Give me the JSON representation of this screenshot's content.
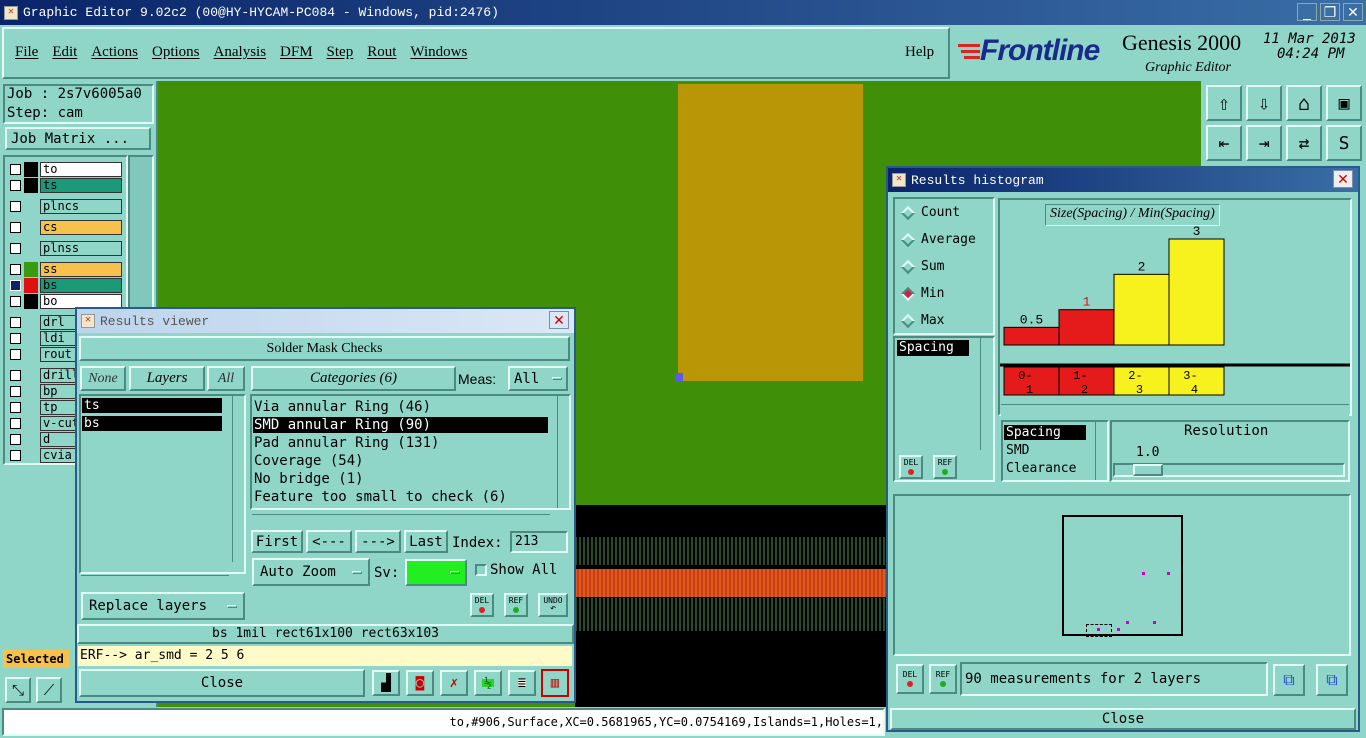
{
  "window": {
    "title": "Graphic Editor 9.02c2 (00@HY-HYCAM-PC084 - Windows, pid:2476)"
  },
  "menu": {
    "items": [
      "File",
      "Edit",
      "Actions",
      "Options",
      "Analysis",
      "DFM",
      "Step",
      "Rout",
      "Windows"
    ],
    "help": "Help"
  },
  "brand": {
    "logo": "Frontline",
    "product": "Genesis 2000",
    "subtitle": "Graphic Editor",
    "date": "11 Mar 2013",
    "time": "04:24 PM"
  },
  "job": {
    "job_label": "Job : 2s7v6005a0",
    "step_label": "Step: cam",
    "matrix_button": "Job Matrix ..."
  },
  "layers": [
    {
      "name": "to",
      "color": "#ffffff",
      "swatch": "#000000"
    },
    {
      "name": "ts",
      "color": "#1b9a7a",
      "swatch": "#000000"
    },
    {
      "name": "plncs",
      "color": "#8fd6c9",
      "swatch": ""
    },
    {
      "name": "cs",
      "color": "#f6c24b",
      "swatch": ""
    },
    {
      "name": "plnss",
      "color": "#8fd6c9",
      "swatch": ""
    },
    {
      "name": "ss",
      "color": "#f6c24b",
      "swatch": "#3a9a10"
    },
    {
      "name": "bs",
      "color": "#1b9a7a",
      "swatch": "#e01010"
    },
    {
      "name": "bo",
      "color": "#ffffff",
      "swatch": "#000000"
    },
    {
      "name": "drl",
      "color": "#8fd6c9",
      "swatch": ""
    },
    {
      "name": "ldi",
      "color": "#8fd6c9",
      "swatch": ""
    },
    {
      "name": "rout",
      "color": "#8fd6c9",
      "swatch": ""
    },
    {
      "name": "drill",
      "color": "#8fd6c9",
      "swatch": ""
    },
    {
      "name": "bp",
      "color": "#8fd6c9",
      "swatch": ""
    },
    {
      "name": "tp",
      "color": "#8fd6c9",
      "swatch": ""
    },
    {
      "name": "v-cut",
      "color": "#8fd6c9",
      "swatch": ""
    },
    {
      "name": "d",
      "color": "#8fd6c9",
      "swatch": ""
    },
    {
      "name": "cvia",
      "color": "#8fd6c9",
      "swatch": ""
    }
  ],
  "selected_label": "Selected",
  "status_bar": "to,#906,Surface,XC=0.5681965,YC=0.0754169,Islands=1,Holes=1,",
  "results_viewer": {
    "title": "Results viewer",
    "header": "Solder Mask Checks",
    "none_btn": "None",
    "layers_btn": "Layers",
    "all_btn": "All",
    "categories_btn": "Categories (6)",
    "meas_label": "Meas:",
    "meas_value": "All",
    "layer_list": [
      "ts",
      "bs"
    ],
    "categories": [
      "Via annular Ring (46)",
      "SMD annular Ring (90)",
      "Pad annular Ring (131)",
      "Coverage (54)",
      "No bridge (1)",
      "Feature too small to check (6)"
    ],
    "selected_category_index": 1,
    "first_btn": "First",
    "prev_btn": "<---",
    "next_btn": "--->",
    "last_btn": "Last",
    "index_label": "Index:",
    "index_value": "213",
    "zoom_btn": "Auto Zoom",
    "sv_label": "Sv:",
    "show_all_label": "Show All",
    "replace_btn": "Replace layers",
    "del_label": "DEL",
    "ref_label": "REF",
    "undo_label": "UNDO",
    "info_line": "bs 1mil   rect61x100   rect63x103",
    "erf_line": "ERF--> ar_smd = 2 5 6",
    "close_btn": "Close"
  },
  "histogram": {
    "title": "Results histogram",
    "modes": [
      "Count",
      "Average",
      "Sum",
      "Min",
      "Max"
    ],
    "selected_mode": "Min",
    "measure_list": [
      "Spacing"
    ],
    "chart_title": "Size(Spacing) / Min(Spacing)",
    "sort_list": [
      "Spacing",
      "SMD",
      "Clearance"
    ],
    "resolution_label": "Resolution",
    "resolution_value": "1.0",
    "del_label": "DEL",
    "ref_label": "REF",
    "summary": "90 measurements for 2 layers",
    "close_btn": "Close"
  },
  "chart_data": {
    "type": "bar",
    "title": "Size(Spacing) / Min(Spacing)",
    "categories": [
      "0-1",
      "1-2",
      "2-3",
      "3-4"
    ],
    "values": [
      0.5,
      1,
      2,
      3
    ],
    "value_labels": [
      "0.5",
      "1",
      "2",
      "3"
    ],
    "bar_colors": [
      "#e51a1a",
      "#e51a1a",
      "#f7f21e",
      "#f7f21e"
    ],
    "ylim": [
      0,
      3
    ]
  },
  "colors": {
    "panel": "#8fd6c9",
    "canvas_green": "#3f8f08",
    "gold": "#b89605",
    "title_blue": "#0a246a"
  }
}
